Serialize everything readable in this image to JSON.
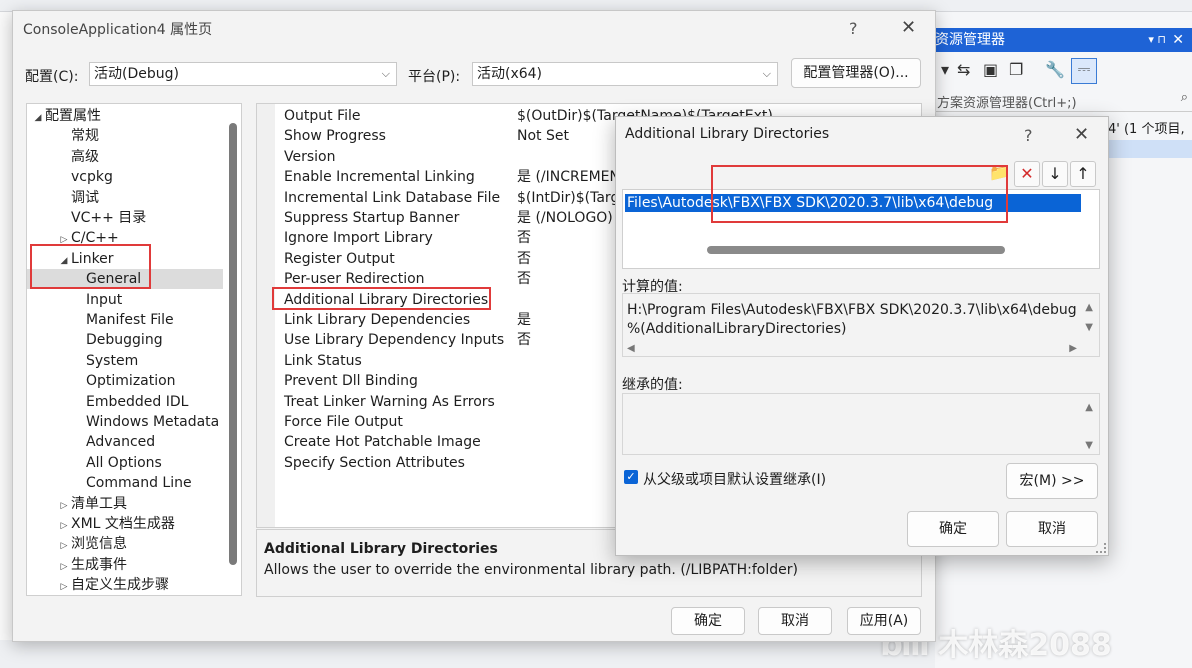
{
  "background": {
    "solution_explorer_title": "资源管理器",
    "solution_search_placeholder": "方案资源管理器(Ctrl+;)",
    "solution_item_text": "4' (1 个项目,",
    "watermark": "木林森2088"
  },
  "main_dialog": {
    "title": "ConsoleApplication4 属性页",
    "help_glyph": "?",
    "close_glyph": "✕",
    "config_label": "配置(C):",
    "config_value": "活动(Debug)",
    "platform_label": "平台(P):",
    "platform_value": "活动(x64)",
    "config_manager_button": "配置管理器(O)...",
    "tree": [
      {
        "label": "配置属性",
        "expander": "◢",
        "level": 0
      },
      {
        "label": "常规",
        "expander": "",
        "level": 1
      },
      {
        "label": "高级",
        "expander": "",
        "level": 1
      },
      {
        "label": "vcpkg",
        "expander": "",
        "level": 1
      },
      {
        "label": "调试",
        "expander": "",
        "level": 1
      },
      {
        "label": "VC++ 目录",
        "expander": "",
        "level": 1
      },
      {
        "label": "C/C++",
        "expander": "▷",
        "level": 1
      },
      {
        "label": "Linker",
        "expander": "◢",
        "level": 1
      },
      {
        "label": "General",
        "expander": "",
        "level": 2,
        "selected": true
      },
      {
        "label": "Input",
        "expander": "",
        "level": 2
      },
      {
        "label": "Manifest File",
        "expander": "",
        "level": 2
      },
      {
        "label": "Debugging",
        "expander": "",
        "level": 2
      },
      {
        "label": "System",
        "expander": "",
        "level": 2
      },
      {
        "label": "Optimization",
        "expander": "",
        "level": 2
      },
      {
        "label": "Embedded IDL",
        "expander": "",
        "level": 2
      },
      {
        "label": "Windows Metadata",
        "expander": "",
        "level": 2
      },
      {
        "label": "Advanced",
        "expander": "",
        "level": 2
      },
      {
        "label": "All Options",
        "expander": "",
        "level": 2
      },
      {
        "label": "Command Line",
        "expander": "",
        "level": 2
      },
      {
        "label": "清单工具",
        "expander": "▷",
        "level": 1
      },
      {
        "label": "XML 文档生成器",
        "expander": "▷",
        "level": 1
      },
      {
        "label": "浏览信息",
        "expander": "▷",
        "level": 1
      },
      {
        "label": "生成事件",
        "expander": "▷",
        "level": 1
      },
      {
        "label": "自定义生成步骤",
        "expander": "▷",
        "level": 1
      }
    ],
    "properties": [
      {
        "name": "Output File",
        "value": "$(OutDir)$(TargetName)$(TargetExt)"
      },
      {
        "name": "Show Progress",
        "value": "Not Set"
      },
      {
        "name": "Version",
        "value": ""
      },
      {
        "name": "Enable Incremental Linking",
        "value": "是 (/INCREMEN"
      },
      {
        "name": "Incremental Link Database File",
        "value": "$(IntDir)$(Targ"
      },
      {
        "name": "Suppress Startup Banner",
        "value": "是 (/NOLOGO)"
      },
      {
        "name": "Ignore Import Library",
        "value": "否"
      },
      {
        "name": "Register Output",
        "value": "否"
      },
      {
        "name": "Per-user Redirection",
        "value": "否"
      },
      {
        "name": "Additional Library Directories",
        "value": ""
      },
      {
        "name": "Link Library Dependencies",
        "value": "是"
      },
      {
        "name": "Use Library Dependency Inputs",
        "value": "否"
      },
      {
        "name": "Link Status",
        "value": ""
      },
      {
        "name": "Prevent Dll Binding",
        "value": ""
      },
      {
        "name": "Treat Linker Warning As Errors",
        "value": ""
      },
      {
        "name": "Force File Output",
        "value": ""
      },
      {
        "name": "Create Hot Patchable Image",
        "value": ""
      },
      {
        "name": "Specify Section Attributes",
        "value": ""
      }
    ],
    "description_title": "Additional Library Directories",
    "description_body": "Allows the user to override the environmental library path. (/LIBPATH:folder)",
    "ok_button": "确定",
    "cancel_button": "取消",
    "apply_button": "应用(A)"
  },
  "lib_dialog": {
    "title": "Additional Library Directories",
    "help_glyph": "?",
    "close_glyph": "✕",
    "selected_path": "Files\\Autodesk\\FBX\\FBX SDK\\2020.3.7\\lib\\x64\\debug",
    "evaluated_label": "计算的值:",
    "evaluated_line1": "H:\\Program Files\\Autodesk\\FBX\\FBX SDK\\2020.3.7\\lib\\x64\\debug",
    "evaluated_line2": "%(AdditionalLibraryDirectories)",
    "inherited_label": "继承的值:",
    "inherit_checkbox_label": "从父级或项目默认设置继承(I)",
    "inherit_checked": true,
    "macros_button": "宏(M) >>",
    "ok_button": "确定",
    "cancel_button": "取消"
  },
  "colors": {
    "selection": "#0a64d6",
    "highlight_red": "#e03a3a",
    "tree_selected": "#dcdcdc",
    "title_bar_blue": "#1e63d6"
  }
}
